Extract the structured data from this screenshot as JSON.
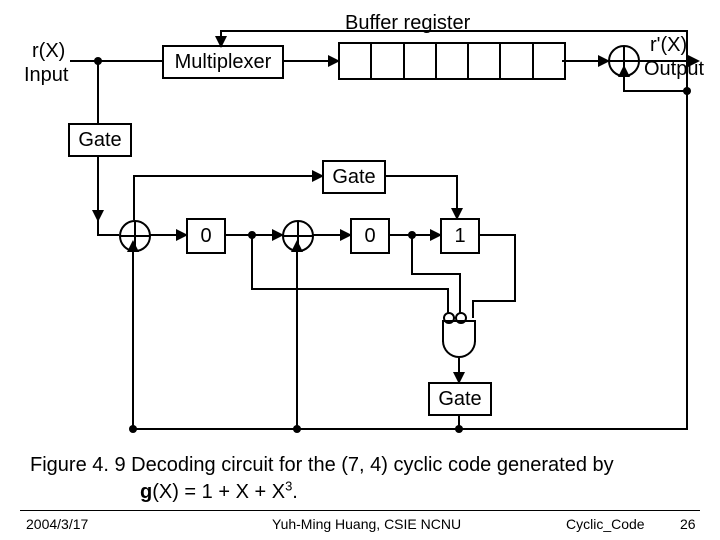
{
  "labels": {
    "buffer_register": "Buffer register",
    "rX": "r(X)",
    "input": "Input",
    "rpX": "r'(X)",
    "output": "Output",
    "multiplexer": "Multiplexer",
    "gate1": "Gate",
    "gate2": "Gate",
    "gate3": "Gate",
    "reg0a": "0",
    "reg0b": "0",
    "reg1": "1"
  },
  "caption": {
    "line1": "Figure 4. 9 Decoding circuit for the (7, 4) cyclic code generated by",
    "line2_prefix": "g",
    "line2_rest": "(X) = 1 + X + X",
    "line2_exp": "3",
    "line2_end": "."
  },
  "footer": {
    "date": "2004/3/17",
    "author": "Yuh-Ming Huang, CSIE NCNU",
    "topic": "Cyclic_Code",
    "page": "26"
  },
  "chart_data": {
    "type": "diagram",
    "title": "Decoding circuit for the (7,4) cyclic code",
    "generator_polynomial": "g(X) = 1 + X + X^3",
    "components": [
      {
        "id": "input",
        "type": "port",
        "label": "r(X) Input"
      },
      {
        "id": "mux",
        "type": "multiplexer",
        "label": "Multiplexer"
      },
      {
        "id": "buffer",
        "type": "buffer_register",
        "cells": 7,
        "label": "Buffer register"
      },
      {
        "id": "xor_out",
        "type": "xor"
      },
      {
        "id": "output",
        "type": "port",
        "label": "r'(X) Output"
      },
      {
        "id": "gate_top",
        "type": "gate_block",
        "label": "Gate"
      },
      {
        "id": "gate_mid",
        "type": "gate_block",
        "label": "Gate"
      },
      {
        "id": "xor_a",
        "type": "xor"
      },
      {
        "id": "reg0a",
        "type": "register",
        "value": 0
      },
      {
        "id": "xor_b",
        "type": "xor"
      },
      {
        "id": "reg0b",
        "type": "register",
        "value": 0
      },
      {
        "id": "reg1",
        "type": "register",
        "value": 1
      },
      {
        "id": "and",
        "type": "and_gate"
      },
      {
        "id": "gate_bot",
        "type": "gate_block",
        "label": "Gate"
      }
    ],
    "connections": [
      [
        "input",
        "mux"
      ],
      [
        "input",
        "gate_top"
      ],
      [
        "mux",
        "buffer"
      ],
      [
        "buffer",
        "xor_out"
      ],
      [
        "xor_out",
        "output"
      ],
      [
        "gate_top",
        "xor_a"
      ],
      [
        "xor_a",
        "reg0a"
      ],
      [
        "reg0a",
        "xor_b"
      ],
      [
        "xor_b",
        "reg0b"
      ],
      [
        "reg0b",
        "gate_mid"
      ],
      [
        "gate_mid",
        "reg1"
      ],
      [
        "reg1",
        "and"
      ],
      [
        "reg0b",
        "and",
        "inverted"
      ],
      [
        "reg0a",
        "and",
        "inverted_via_bottom"
      ],
      [
        "and",
        "gate_bot"
      ],
      [
        "gate_bot",
        "xor_a",
        "feedback"
      ],
      [
        "gate_bot",
        "xor_b",
        "feedback"
      ],
      [
        "gate_bot",
        "mux",
        "feedback"
      ],
      [
        "gate_bot",
        "xor_out",
        "feedback"
      ]
    ]
  }
}
